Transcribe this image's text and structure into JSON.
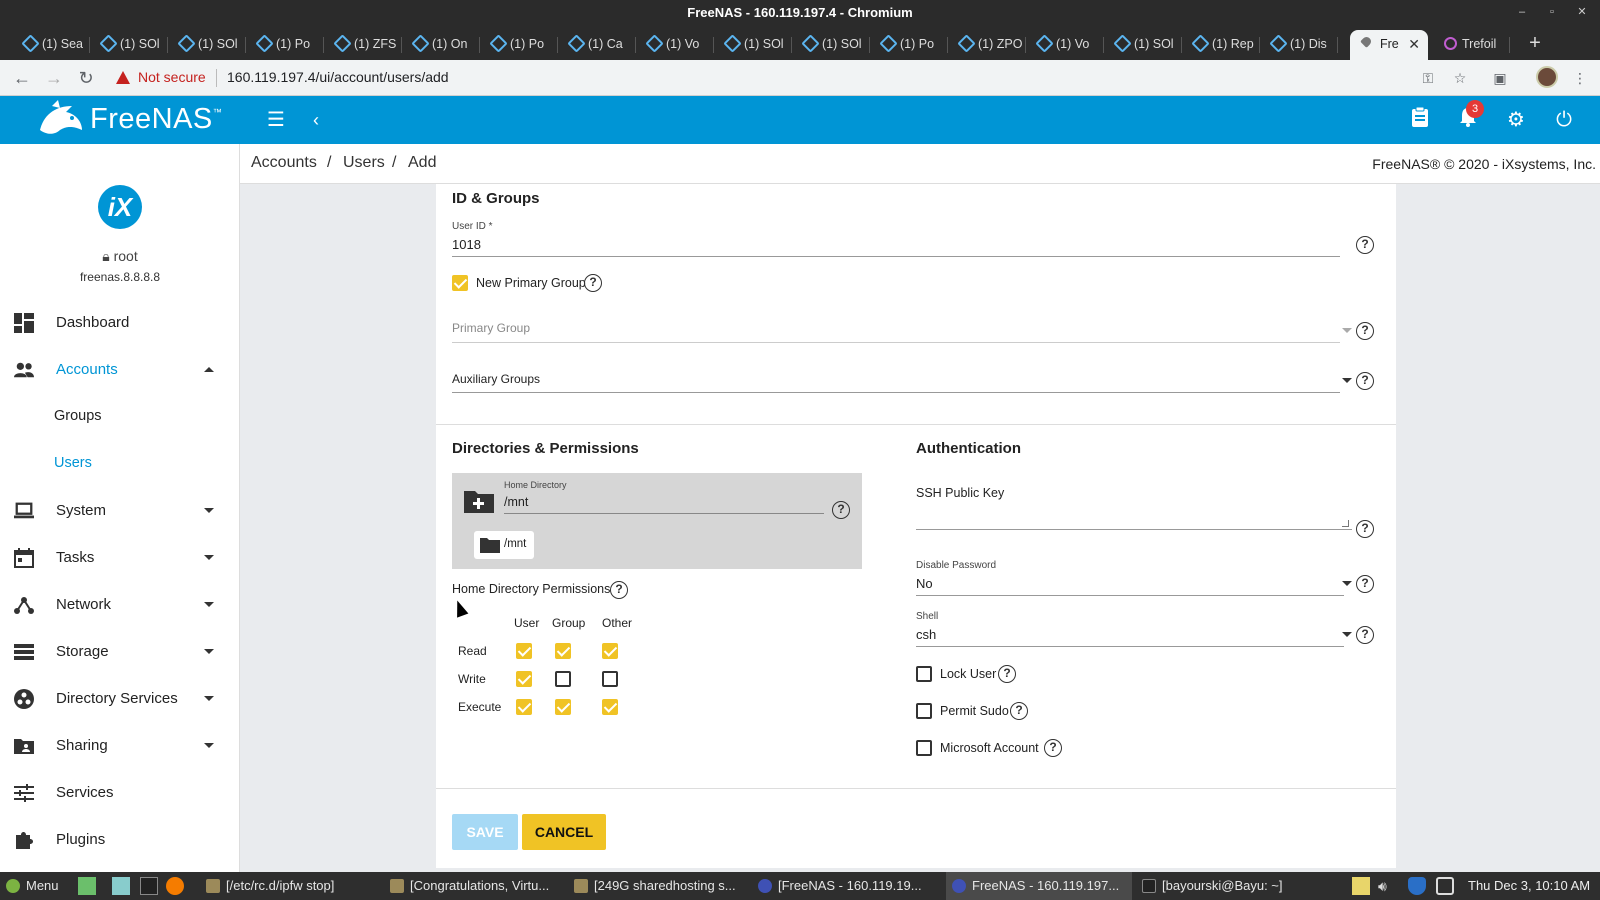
{
  "window": {
    "title": "FreeNAS - 160.119.197.4 - Chromium"
  },
  "tabs": [
    {
      "label": "(1) Sea",
      "icon": "site-icon"
    },
    {
      "label": "(1) SOl",
      "icon": "site-icon"
    },
    {
      "label": "(1) SOl",
      "icon": "site-icon"
    },
    {
      "label": "(1) Po",
      "icon": "site-icon"
    },
    {
      "label": "(1) ZFS",
      "icon": "site-icon"
    },
    {
      "label": "(1) On",
      "icon": "site-icon"
    },
    {
      "label": "(1) Po",
      "icon": "site-icon"
    },
    {
      "label": "(1) Ca",
      "icon": "site-icon"
    },
    {
      "label": "(1) Vo",
      "icon": "site-icon"
    },
    {
      "label": "(1) SOl",
      "icon": "site-icon"
    },
    {
      "label": "(1) SOl",
      "icon": "site-icon"
    },
    {
      "label": "(1) Po",
      "icon": "site-icon"
    },
    {
      "label": "(1) ZPO",
      "icon": "site-icon"
    },
    {
      "label": "(1) Vo",
      "icon": "site-icon"
    },
    {
      "label": "(1) SOl",
      "icon": "site-icon"
    },
    {
      "label": "(1) Rep",
      "icon": "site-icon"
    },
    {
      "label": "(1) Dis",
      "icon": "site-icon"
    },
    {
      "label": "Fre",
      "icon": "freenas-icon",
      "active": true
    },
    {
      "label": "Trefoil",
      "icon": "ring-icon"
    }
  ],
  "toolbar": {
    "security": "Not secure",
    "url": "160.119.197.4/ui/account/users/add"
  },
  "header": {
    "brand": "FreeNAS",
    "notifications_count": "3"
  },
  "breadcrumb": {
    "accounts": "Accounts",
    "users": "Users",
    "add": "Add",
    "sep": "/"
  },
  "copyright": "FreeNAS® © 2020 - iXsystems, Inc.",
  "sidebar": {
    "user": "root",
    "host": "freenas.8.8.8.8",
    "items": [
      {
        "label": "Dashboard"
      },
      {
        "label": "Accounts"
      },
      {
        "label": "Groups"
      },
      {
        "label": "Users"
      },
      {
        "label": "System"
      },
      {
        "label": "Tasks"
      },
      {
        "label": "Network"
      },
      {
        "label": "Storage"
      },
      {
        "label": "Directory Services"
      },
      {
        "label": "Sharing"
      },
      {
        "label": "Services"
      },
      {
        "label": "Plugins"
      }
    ]
  },
  "form": {
    "id_groups_title": "ID & Groups",
    "user_id_label": "User ID *",
    "user_id_value": "1018",
    "new_primary_group_label": "New Primary Group",
    "primary_group_placeholder": "Primary Group",
    "auxiliary_groups_label": "Auxiliary Groups",
    "dirs_title": "Directories & Permissions",
    "home_dir_label": "Home Directory",
    "home_dir_value": "/mnt",
    "home_dir_chip": "/mnt",
    "home_perm_label": "Home Directory Permissions",
    "perm_cols": [
      "User",
      "Group",
      "Other"
    ],
    "perm_rows": [
      "Read",
      "Write",
      "Execute"
    ],
    "auth_title": "Authentication",
    "ssh_label": "SSH Public Key",
    "disable_password_label": "Disable Password",
    "disable_password_value": "No",
    "shell_label": "Shell",
    "shell_value": "csh",
    "lock_user_label": "Lock User",
    "permit_sudo_label": "Permit Sudo",
    "microsoft_account_label": "Microsoft Account",
    "save_label": "SAVE",
    "cancel_label": "CANCEL"
  },
  "taskbar": {
    "menu": "Menu",
    "tasks": [
      "[/etc/rc.d/ipfw stop]",
      "[Congratulations, Virtu...",
      "[249G sharedhosting s...",
      "[FreeNAS - 160.119.19...",
      "FreeNAS - 160.119.197...",
      "[bayourski@Bayu: ~]"
    ],
    "clock": "Thu Dec 3, 10:10 AM"
  },
  "colors": {
    "accent": "#0095d5",
    "checkbox": "#f0c325",
    "save_disabled": "#a6d9f5",
    "cancel": "#f0c325"
  }
}
